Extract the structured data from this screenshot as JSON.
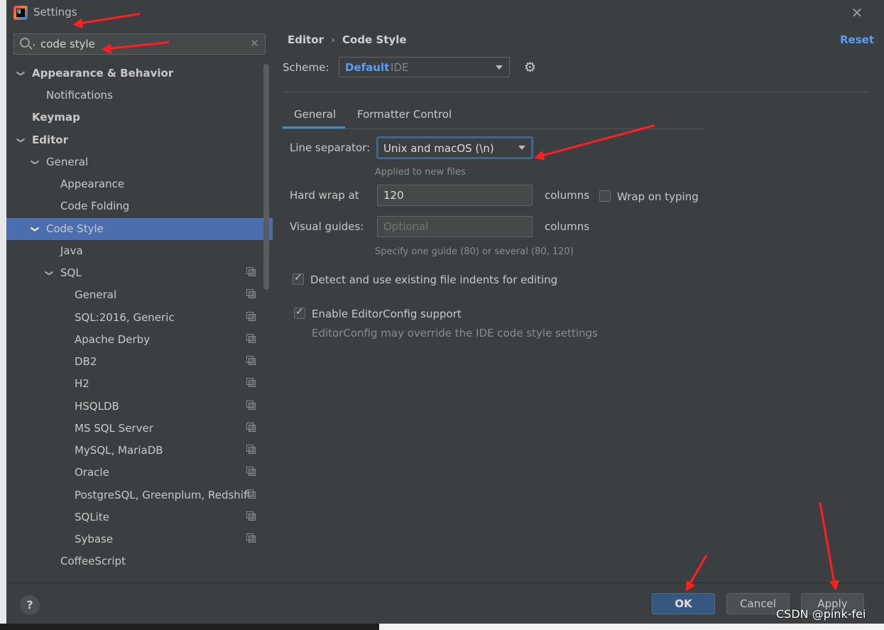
{
  "window": {
    "title": "Settings",
    "close_icon": "close-icon",
    "logo_text": "IJ"
  },
  "search": {
    "value": "code style",
    "placeholder": ""
  },
  "tree": [
    {
      "label": "Appearance & Behavior",
      "bold": true,
      "expanded": true
    },
    {
      "label": "Notifications"
    },
    {
      "label": "Keymap",
      "bold": true
    },
    {
      "label": "Editor",
      "bold": true,
      "expanded": true
    },
    {
      "label": "General",
      "expanded": true
    },
    {
      "label": "Appearance"
    },
    {
      "label": "Code Folding"
    },
    {
      "label": "Code Style",
      "expanded": true,
      "selected": true
    },
    {
      "label": "Java"
    },
    {
      "label": "SQL",
      "expanded": true
    },
    {
      "label": "General"
    },
    {
      "label": "SQL:2016, Generic"
    },
    {
      "label": "Apache Derby"
    },
    {
      "label": "DB2"
    },
    {
      "label": "H2"
    },
    {
      "label": "HSQLDB"
    },
    {
      "label": "MS SQL Server"
    },
    {
      "label": "MySQL, MariaDB"
    },
    {
      "label": "Oracle"
    },
    {
      "label": "PostgreSQL, Greenplum, Redshift"
    },
    {
      "label": "SQLite"
    },
    {
      "label": "Sybase"
    },
    {
      "label": "CoffeeScript"
    }
  ],
  "breadcrumb": {
    "parent": "Editor",
    "separator": "›",
    "current": "Code Style"
  },
  "reset_label": "Reset",
  "scheme": {
    "label": "Scheme:",
    "name": "Default",
    "kind": "IDE"
  },
  "tabs": [
    {
      "label": "General",
      "active": true
    },
    {
      "label": "Formatter Control",
      "active": false
    }
  ],
  "general": {
    "line_separator_label": "Line separator:",
    "line_separator_value": "Unix and macOS (\\n)",
    "line_separator_hint": "Applied to new files",
    "hard_wrap_label": "Hard wrap at",
    "hard_wrap_value": "120",
    "columns_label": "columns",
    "wrap_on_typing_label": "Wrap on typing",
    "wrap_on_typing_checked": false,
    "visual_guides_label": "Visual guides:",
    "visual_guides_placeholder": "Optional",
    "visual_guides_hint": "Specify one guide (80) or several (80, 120)",
    "detect_indents_label": "Detect and use existing file indents for editing",
    "detect_indents_checked": true,
    "editorconfig_label": "Enable EditorConfig support",
    "editorconfig_checked": true,
    "editorconfig_hint": "EditorConfig may override the IDE code style settings"
  },
  "footer": {
    "help_label": "?",
    "ok_label": "OK",
    "cancel_label": "Cancel",
    "apply_label": "Apply"
  },
  "watermark": "CSDN @pink-fei",
  "colors": {
    "accent": "#589df6",
    "selection": "#4b6eaf",
    "annotation": "#ff1f1f"
  }
}
